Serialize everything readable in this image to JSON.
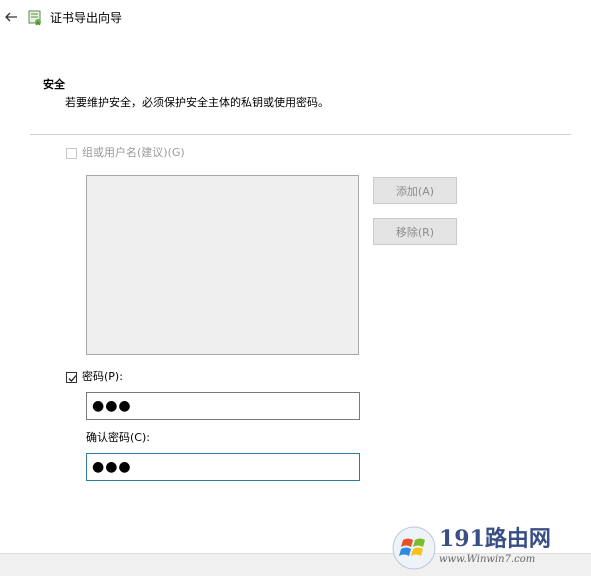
{
  "header": {
    "title": "证书导出向导"
  },
  "section": {
    "heading": "安全",
    "description": "若要维护安全，必须保护安全主体的私钥或使用密码。"
  },
  "group": {
    "checkbox_label": "组或用户名(建议)(G)",
    "checked": false,
    "enabled": false,
    "add_button": "添加(A)",
    "remove_button": "移除(R)"
  },
  "password": {
    "checkbox_label": "密码(P):",
    "checked": true,
    "value": "●●●",
    "confirm_label": "确认密码(C):",
    "confirm_value": "●●●"
  },
  "watermark": {
    "brand_text": "191路由网",
    "url": "www.Winwin7.com"
  },
  "icons": {
    "back": "back-arrow-icon",
    "wizard": "certificate-wizard-icon",
    "check": "checkmark-icon",
    "logo": "windows-logo-icon"
  }
}
